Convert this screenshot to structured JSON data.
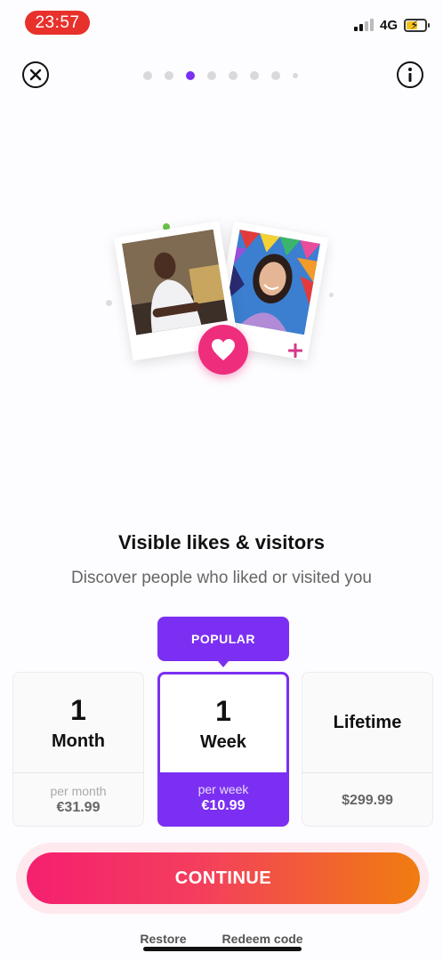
{
  "status_bar": {
    "time": "23:57",
    "network": "4G"
  },
  "pagination": {
    "total": 8,
    "active_index": 2
  },
  "content": {
    "title": "Visible likes & visitors",
    "subtitle": "Discover people who liked or visited you"
  },
  "plans": {
    "popular_label": "POPULAR",
    "items": [
      {
        "number": "1",
        "unit": "Month",
        "per": "per month",
        "price": "€31.99"
      },
      {
        "number": "1",
        "unit": "Week",
        "per": "per week",
        "price": "€10.99"
      },
      {
        "number": "",
        "unit": "Lifetime",
        "per": "",
        "price": "$299.99"
      }
    ],
    "selected_index": 1
  },
  "actions": {
    "continue_label": "CONTINUE",
    "restore_label": "Restore",
    "redeem_label": "Redeem code"
  },
  "colors": {
    "accent": "#7b2ff2",
    "heart": "#ee2d7d",
    "status_pill": "#e8312b",
    "continue_gradient_start": "#f51f6f",
    "continue_gradient_end": "#ef7d0f"
  },
  "icons": {
    "close": "close-icon",
    "info": "info-icon",
    "heart": "heart-icon",
    "plus": "plus-icon"
  }
}
